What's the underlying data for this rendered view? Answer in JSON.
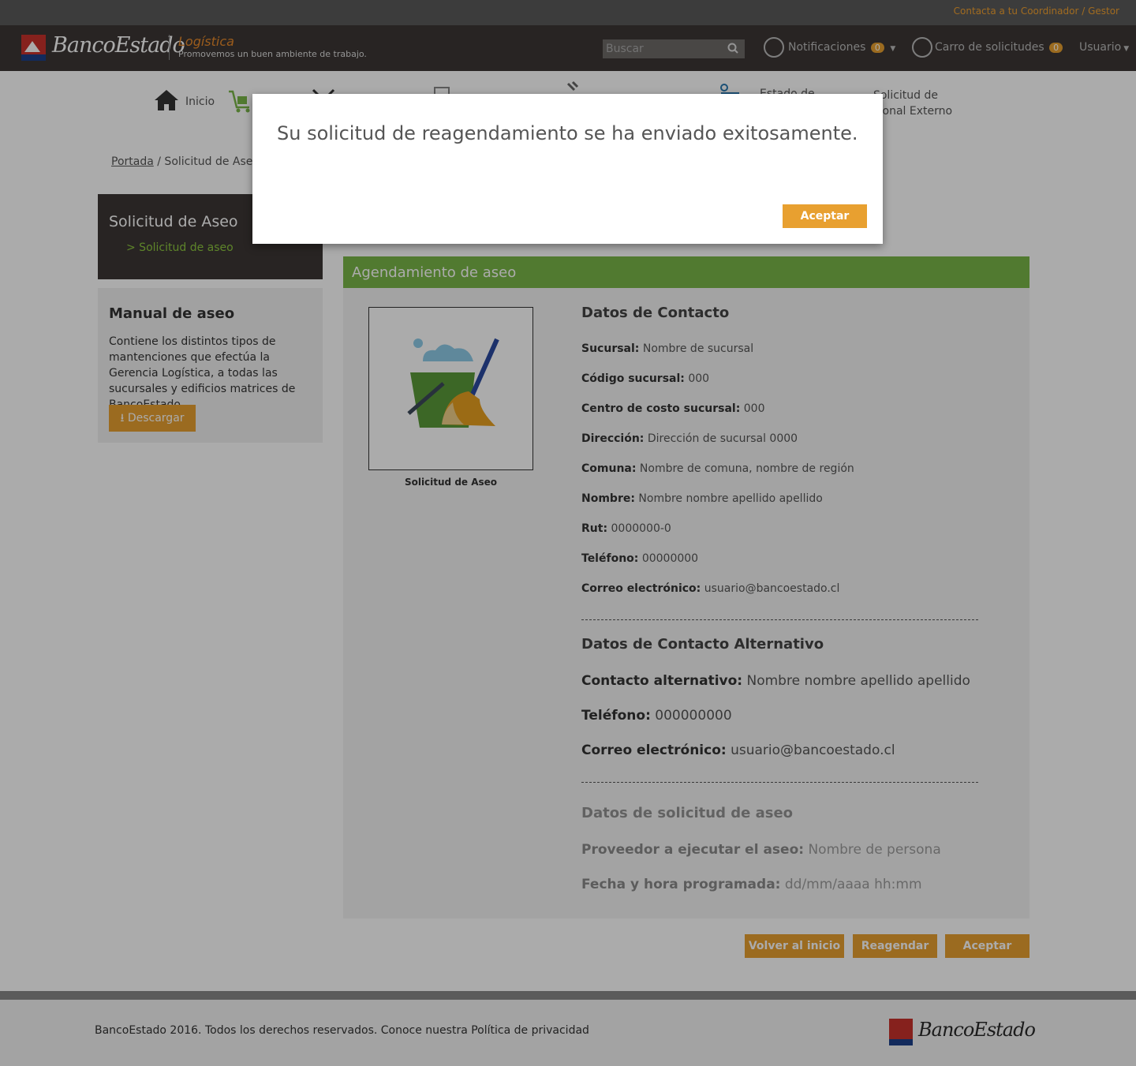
{
  "topbar": {
    "contact_link": "Contacta a tu Coordinador / Gestor"
  },
  "header": {
    "logo_text": "BancoEstado",
    "section_title": "Logística",
    "tagline": "Promovemos un buen ambiente de trabajo.",
    "search_placeholder": "Buscar",
    "notifications_label": "Notificaciones",
    "notifications_count": "0",
    "cart_label": "Carro de solicitudes",
    "cart_count": "0",
    "user_label": "Usuario"
  },
  "nav": {
    "home_label": "Inicio",
    "estado_label": "Estado de",
    "personal_label": "Solicitud de Personal Externo"
  },
  "breadcrumb": {
    "root": "Portada",
    "current": "/ Solicitud de Aseo"
  },
  "sidebar": {
    "menu_title": "Solicitud de Aseo",
    "menu_item": ">  Solicitud de aseo",
    "manual_title": "Manual de aseo",
    "manual_desc": "Contiene los distintos tipos de mantenciones que efectúa la Gerencia Logística, a todas las sucursales y edificios matrices de BancoEstado.",
    "download_label": "Descargar"
  },
  "panel": {
    "title": "Agendamiento de aseo",
    "image_caption": "Solicitud de Aseo",
    "contact": {
      "title": "Datos de Contacto",
      "fields": [
        {
          "label": "Sucursal:",
          "value": "Nombre de sucursal"
        },
        {
          "label": "Código sucursal:",
          "value": "000"
        },
        {
          "label": "Centro de costo sucursal:",
          "value": "000"
        },
        {
          "label": "Dirección:",
          "value": "Dirección de sucursal 0000"
        },
        {
          "label": "Comuna:",
          "value": "Nombre de comuna, nombre de región"
        },
        {
          "label": "Nombre:",
          "value": "Nombre nombre apellido apellido"
        },
        {
          "label": "Rut:",
          "value": "0000000-0"
        },
        {
          "label": "Teléfono:",
          "value": "00000000"
        },
        {
          "label": "Correo electrónico:",
          "value": "usuario@bancoestado.cl"
        }
      ]
    },
    "alt_contact": {
      "title": "Datos de Contacto Alternativo",
      "fields": [
        {
          "label": "Contacto alternativo:",
          "value": "Nombre nombre apellido apellido"
        },
        {
          "label": "Teléfono:",
          "value": "000000000"
        },
        {
          "label": "Correo electrónico:",
          "value": "usuario@bancoestado.cl"
        }
      ]
    },
    "request": {
      "title": "Datos de solicitud de aseo",
      "fields": [
        {
          "label": "Proveedor a ejecutar el aseo:",
          "value": "Nombre de persona"
        },
        {
          "label": "Fecha y hora programada:",
          "value": "dd/mm/aaaa hh:mm"
        }
      ]
    }
  },
  "actions": {
    "back_label": "Volver al inicio",
    "reschedule_label": "Reagendar",
    "accept_label": "Aceptar"
  },
  "footer": {
    "text": "BancoEstado 2016. Todos los derechos reservados. Conoce nuestra Política de privacidad",
    "logo_text": "BancoEstado"
  },
  "modal": {
    "message": "Su solicitud de reagendamiento se ha enviado exitosamente.",
    "accept_label": "Aceptar"
  },
  "colors": {
    "accent_orange": "#e8a030",
    "brand_red": "#c8322c",
    "panel_green": "#7ab648",
    "header_dark": "#3c3735"
  }
}
